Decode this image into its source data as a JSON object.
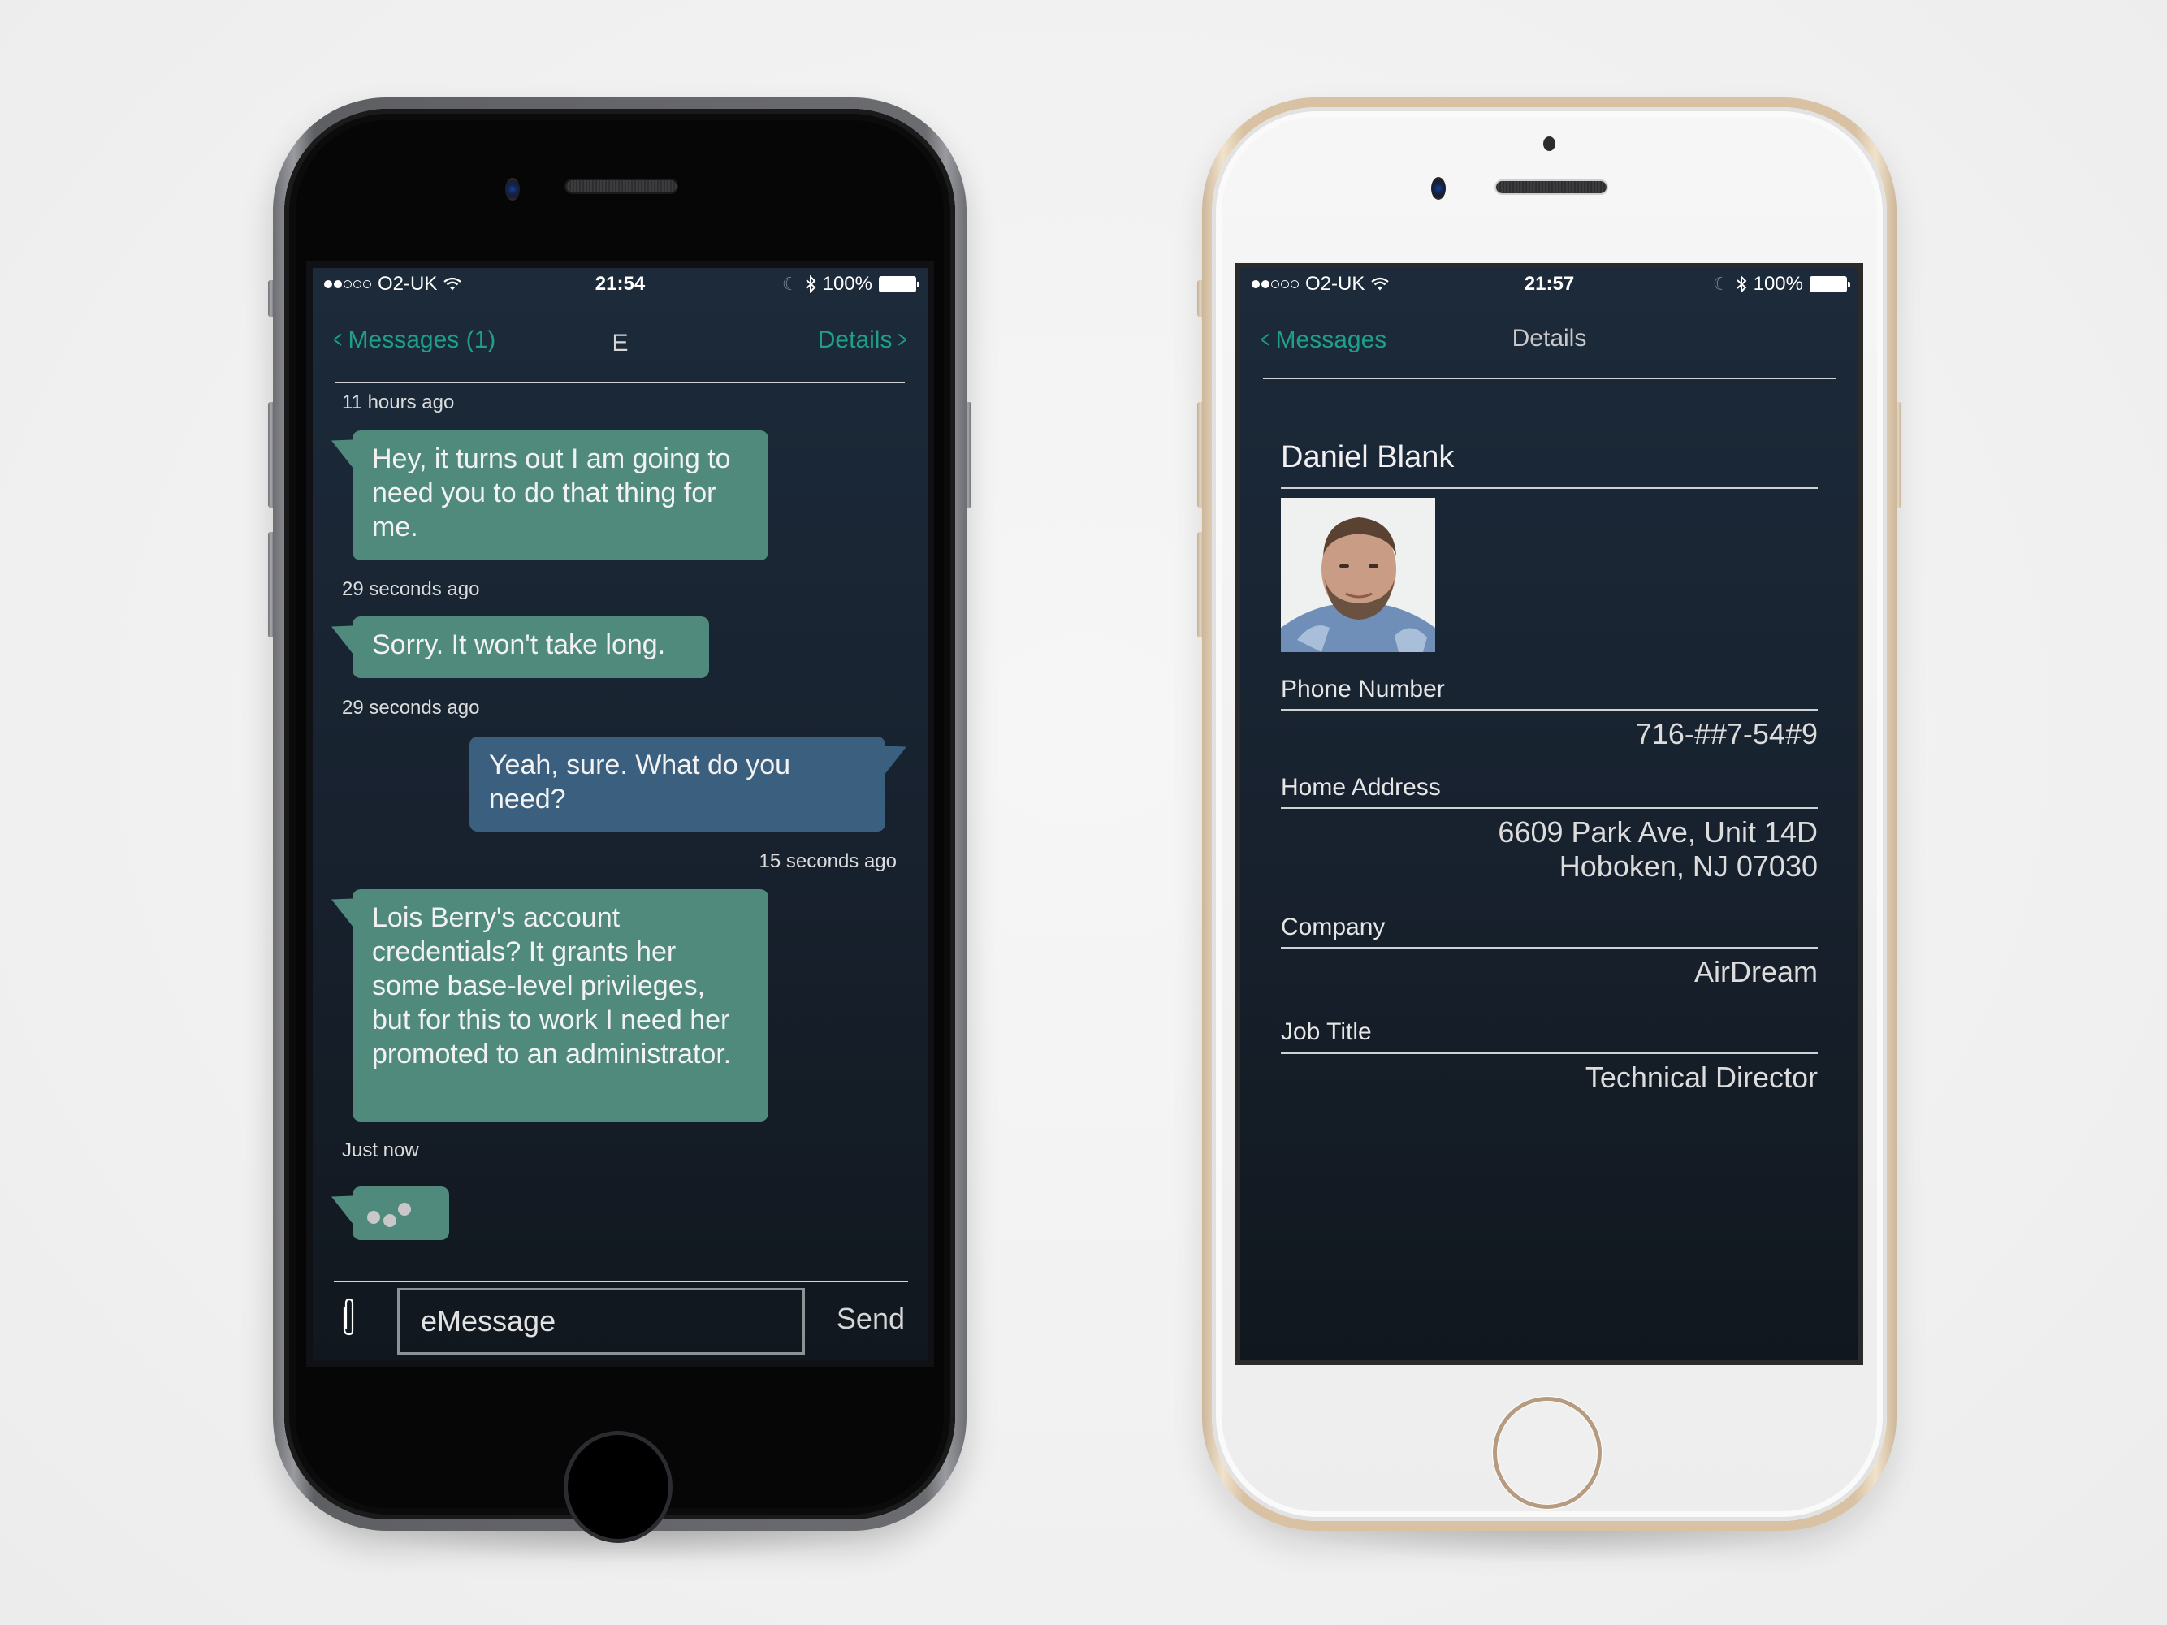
{
  "phone_left": {
    "status": {
      "carrier": "O2-UK",
      "signal_bars_filled": 2,
      "signal_bars_total": 5,
      "time": "21:54",
      "battery": "100%"
    },
    "nav": {
      "back_label": "Messages (1)",
      "title": "E",
      "forward_label": "Details"
    },
    "thread": [
      {
        "type": "timestamp",
        "text": "11 hours ago"
      },
      {
        "type": "incoming",
        "text": "Hey, it turns out I am going to need you to do that thing for me."
      },
      {
        "type": "timestamp",
        "text": "29 seconds ago"
      },
      {
        "type": "incoming",
        "text": "Sorry. It won't take long."
      },
      {
        "type": "timestamp",
        "text": "29 seconds ago"
      },
      {
        "type": "outgoing",
        "text": "Yeah, sure. What do you need?"
      },
      {
        "type": "timestamp",
        "text": "15 seconds ago"
      },
      {
        "type": "incoming",
        "text": "Lois Berry's account credentials? It grants her some base-level privileges, but for this to work I need her promoted to an administrator."
      },
      {
        "type": "timestamp",
        "text": "Just now"
      },
      {
        "type": "typing",
        "text": ""
      }
    ],
    "composer": {
      "placeholder": "eMessage",
      "value": "",
      "send_label": "Send",
      "attach_icon": "paperclip-icon"
    }
  },
  "phone_right": {
    "status": {
      "carrier": "O2-UK",
      "signal_bars_filled": 2,
      "signal_bars_total": 5,
      "time": "21:57",
      "battery": "100%"
    },
    "nav": {
      "back_label": "Messages",
      "title": "Details"
    },
    "contact": {
      "name": "Daniel Blank",
      "photo_alt": "Contact photo of Daniel Blank",
      "fields": [
        {
          "label": "Phone Number",
          "value": "716-##7-54#9"
        },
        {
          "label": "Home Address",
          "value_lines": [
            "6609 Park Ave, Unit 14D",
            "Hoboken, NJ 07030"
          ]
        },
        {
          "label": "Company",
          "value": "AirDream"
        },
        {
          "label": "Job Title",
          "value": "Technical Director"
        }
      ]
    }
  },
  "colors": {
    "accent_teal": "#1f9e8a",
    "incoming_bubble": "#4f8a7d",
    "outgoing_bubble": "#3b5f7e",
    "screen_bg_top": "#1c2a3a",
    "screen_bg_bottom": "#11171e"
  }
}
